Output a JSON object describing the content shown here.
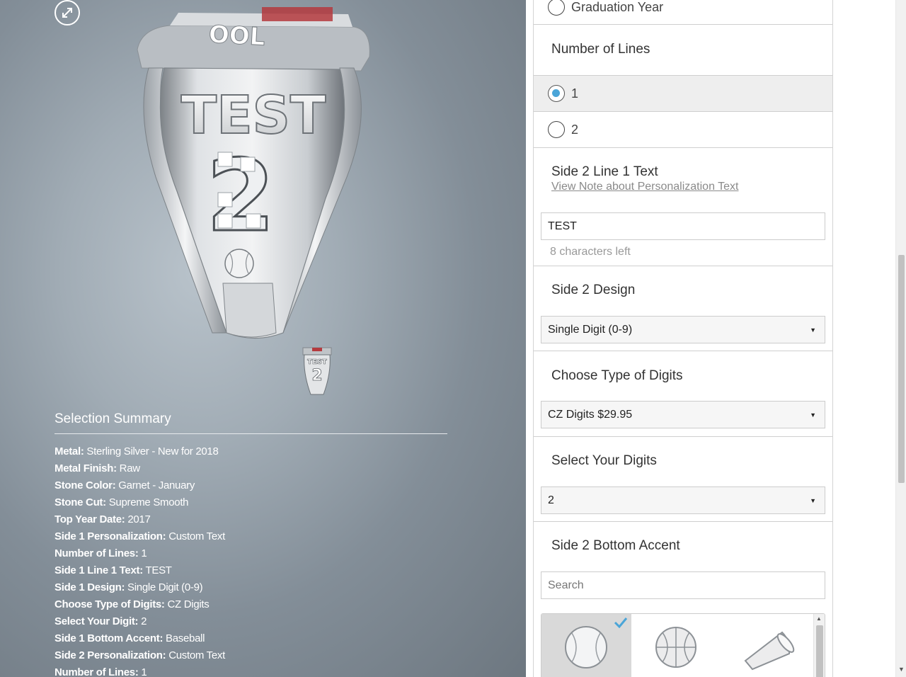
{
  "colors": {
    "accent": "#4aa5d8",
    "panel_bg": "#8f9aa3"
  },
  "ring_preview": {
    "side_text": "TEST",
    "digit": "2",
    "top_text": "OOL",
    "thumb_text": "TEST"
  },
  "summary": {
    "title": "Selection Summary",
    "items": [
      {
        "key": "Metal:",
        "value": "Sterling Silver - New for 2018"
      },
      {
        "key": "Metal Finish:",
        "value": "Raw"
      },
      {
        "key": "Stone Color:",
        "value": "Garnet - January"
      },
      {
        "key": "Stone Cut:",
        "value": "Supreme Smooth"
      },
      {
        "key": "Top Year Date:",
        "value": "2017"
      },
      {
        "key": "Side 1 Personalization:",
        "value": "Custom Text"
      },
      {
        "key": "Number of Lines:",
        "value": "1"
      },
      {
        "key": "Side 1 Line 1 Text:",
        "value": "TEST"
      },
      {
        "key": "Side 1 Design:",
        "value": "Single Digit (0-9)"
      },
      {
        "key": "Choose Type of Digits:",
        "value": "CZ Digits"
      },
      {
        "key": "Select Your Digit:",
        "value": "2"
      },
      {
        "key": "Side 1 Bottom Accent:",
        "value": "Baseball"
      },
      {
        "key": "Side 2 Personalization:",
        "value": "Custom Text"
      },
      {
        "key": "Number of Lines:",
        "value": "1"
      }
    ]
  },
  "config": {
    "graduation_year": {
      "label": "Graduation Year"
    },
    "number_of_lines": {
      "title": "Number of Lines",
      "options": [
        {
          "label": "1",
          "checked": true
        },
        {
          "label": "2",
          "checked": false
        }
      ]
    },
    "line1_text": {
      "title": "Side 2 Line 1 Text",
      "note_link": "View Note about Personalization Text",
      "value": "TEST",
      "chars_left": "8 characters left"
    },
    "side2_design": {
      "title": "Side 2 Design",
      "selected": "Single Digit (0-9)"
    },
    "digit_type": {
      "title": "Choose Type of Digits",
      "selected": "CZ Digits $29.95"
    },
    "select_digits": {
      "title": "Select Your Digits",
      "selected": "2"
    },
    "bottom_accent": {
      "title": "Side 2 Bottom Accent",
      "search_placeholder": "Search",
      "tiles": [
        {
          "icon": "baseball-icon",
          "selected": true
        },
        {
          "icon": "basketball-icon",
          "selected": false
        },
        {
          "icon": "megaphone-icon",
          "selected": false
        }
      ]
    }
  }
}
